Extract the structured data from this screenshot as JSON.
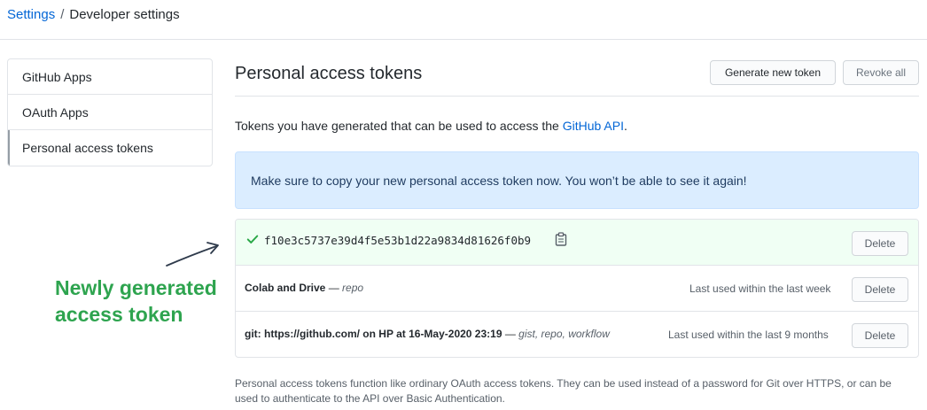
{
  "breadcrumb": {
    "root": "Settings",
    "separator": "/",
    "current": "Developer settings"
  },
  "sidebar": {
    "items": [
      {
        "label": "GitHub Apps"
      },
      {
        "label": "OAuth Apps"
      },
      {
        "label": "Personal access tokens"
      }
    ]
  },
  "main": {
    "title": "Personal access tokens",
    "generate_label": "Generate new token",
    "revoke_label": "Revoke all",
    "intro_text": "Tokens you have generated that can be used to access the ",
    "intro_link": "GitHub API",
    "intro_end": ".",
    "flash": "Make sure to copy your new personal access token now. You won’t be able to see it again!",
    "new_token": {
      "value": "f10e3c5737e39d4f5e53b1d22a9834d81626f0b9",
      "delete_label": "Delete"
    },
    "tokens": [
      {
        "name": "Colab and Drive",
        "dash": " — ",
        "scopes": "repo",
        "last_used": "Last used within the last week",
        "delete_label": "Delete"
      },
      {
        "name": "git: https://github.com/ on HP at 16-May-2020 23:19",
        "dash": " — ",
        "scopes": "gist, repo, workflow",
        "last_used": "Last used within the last 9 months",
        "delete_label": "Delete"
      }
    ],
    "footer_note": "Personal access tokens function like ordinary OAuth access tokens. They can be used instead of a password for Git over HTTPS, or can be used to authenticate to the API over Basic Authentication."
  },
  "annotation": {
    "line1": "Newly generated",
    "line2": "access token",
    "color": "#2ea44f"
  },
  "icons": {
    "check": "check-icon",
    "clipboard": "clipboard-icon",
    "arrow": "arrow-icon"
  }
}
